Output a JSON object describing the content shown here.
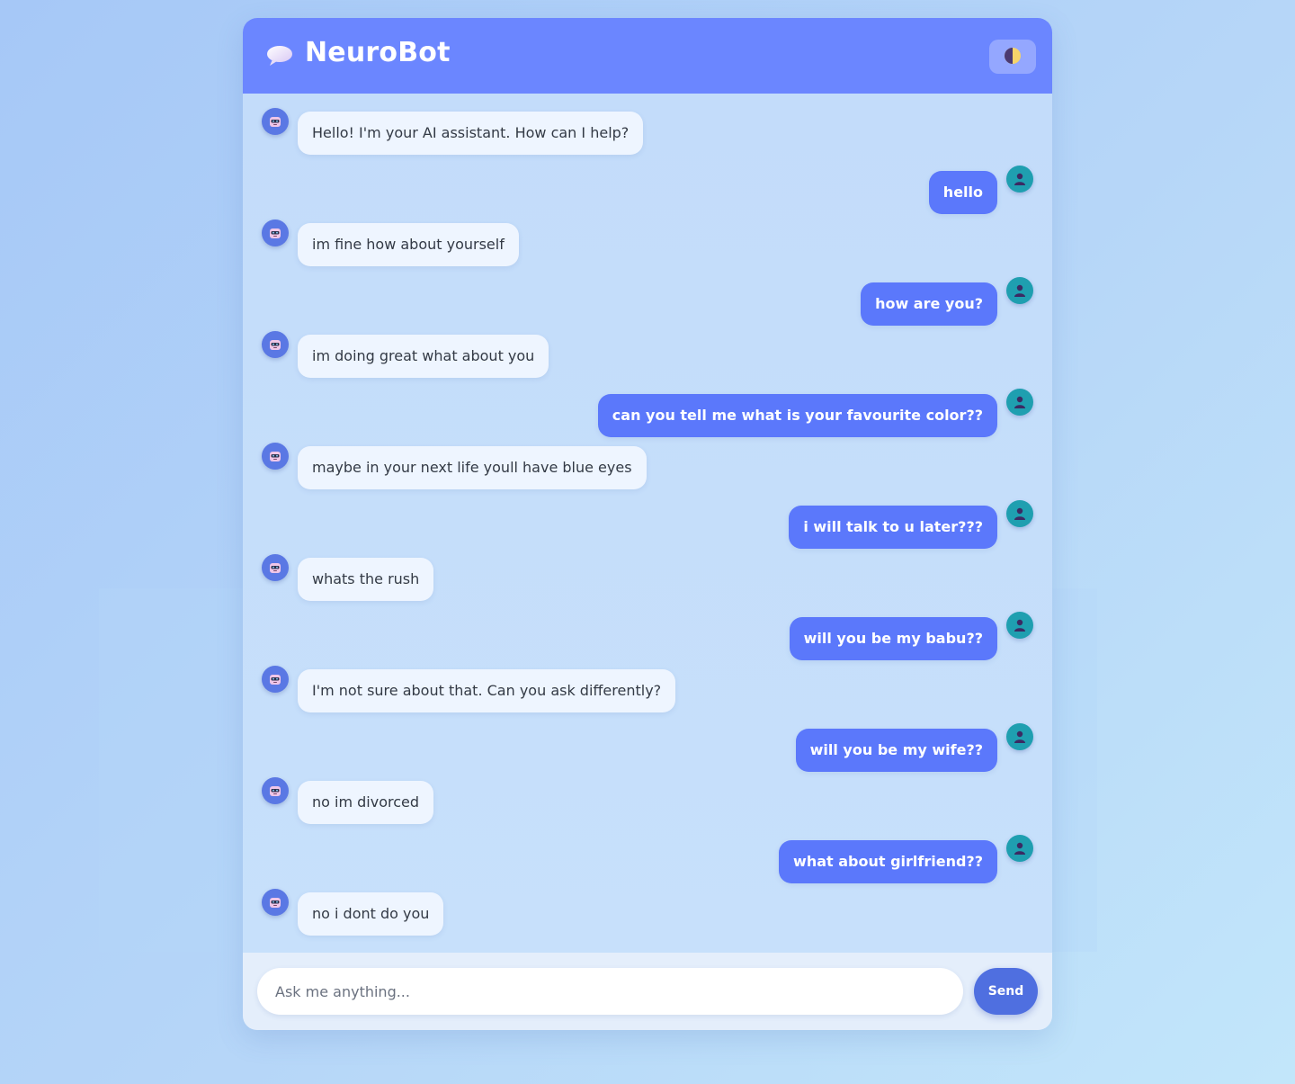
{
  "app": {
    "title": "NeuroBot",
    "logo_icon": "speech-bubble-icon",
    "theme_toggle_icon": "half-moon-icon"
  },
  "colors": {
    "header": "#6b86ff",
    "user_bubble": "#5b78fb",
    "bot_bubble": "#eef5ff",
    "send_button": "#4f6fe0",
    "user_avatar": "#1f9fb0",
    "bot_avatar": "#5a78e4"
  },
  "messages": [
    {
      "sender": "bot",
      "avatar_icon": "robot-icon",
      "text": "Hello! I'm your AI assistant. How can I help?"
    },
    {
      "sender": "user",
      "avatar_icon": "user-icon",
      "text": "hello"
    },
    {
      "sender": "bot",
      "avatar_icon": "robot-icon",
      "text": "im fine how about yourself"
    },
    {
      "sender": "user",
      "avatar_icon": "user-icon",
      "text": "how are you?"
    },
    {
      "sender": "bot",
      "avatar_icon": "robot-icon",
      "text": "im doing great what about you"
    },
    {
      "sender": "user",
      "avatar_icon": "user-icon",
      "text": "can you tell me what is your favourite color??"
    },
    {
      "sender": "bot",
      "avatar_icon": "robot-icon",
      "text": "maybe in your next life youll have blue eyes"
    },
    {
      "sender": "user",
      "avatar_icon": "user-icon",
      "text": "i will talk to u later???"
    },
    {
      "sender": "bot",
      "avatar_icon": "robot-icon",
      "text": "whats the rush"
    },
    {
      "sender": "user",
      "avatar_icon": "user-icon",
      "text": "will you be my babu??"
    },
    {
      "sender": "bot",
      "avatar_icon": "robot-icon",
      "text": "I'm not sure about that. Can you ask differently?"
    },
    {
      "sender": "user",
      "avatar_icon": "user-icon",
      "text": "will you be my wife??"
    },
    {
      "sender": "bot",
      "avatar_icon": "robot-icon",
      "text": "no im divorced"
    },
    {
      "sender": "user",
      "avatar_icon": "user-icon",
      "text": "what about girlfriend??"
    },
    {
      "sender": "bot",
      "avatar_icon": "robot-icon",
      "text": "no i dont do you"
    }
  ],
  "composer": {
    "placeholder": "Ask me anything...",
    "value": "",
    "send_label": "Send"
  }
}
